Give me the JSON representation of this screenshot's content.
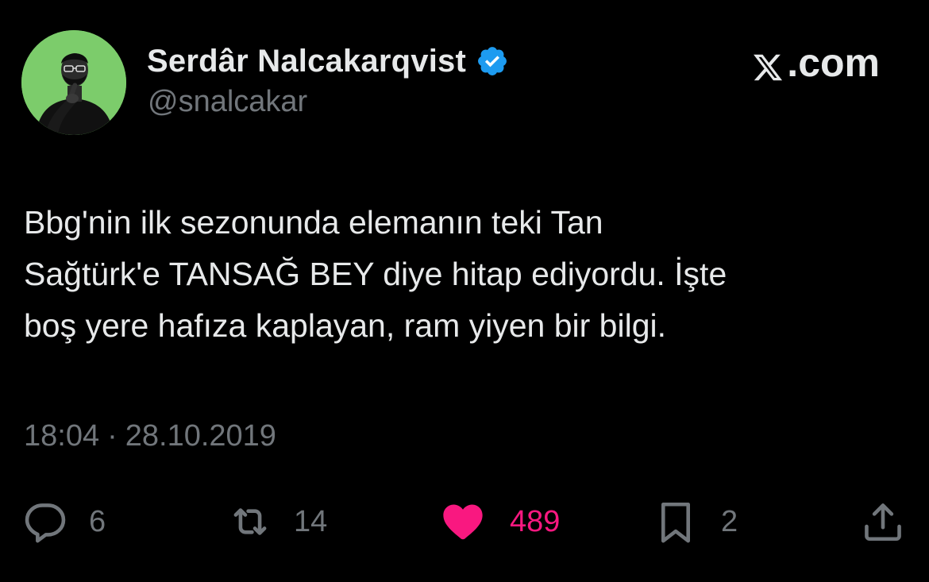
{
  "header": {
    "display_name": "Serdâr Nalcakarqvist",
    "handle": "@snalcakar",
    "verified_icon": "verified-badge-icon",
    "brand": ".com"
  },
  "colors": {
    "background": "#000000",
    "text": "#e7e9ea",
    "muted": "#71767b",
    "verified": "#1d9bf0",
    "like": "#f91880",
    "avatar_bg": "#7ccc6b"
  },
  "tweet": {
    "text": "Bbg'nin ilk sezonunda elemanın teki Tan\nSağtürk'e TANSAĞ BEY diye hitap ediyordu. İşte\nboş yere hafıza kaplayan, ram yiyen bir bilgi.",
    "time": "18:04",
    "separator": "·",
    "date": "28.10.2019"
  },
  "actions": {
    "reply": {
      "icon": "reply-icon",
      "count": "6"
    },
    "retweet": {
      "icon": "retweet-icon",
      "count": "14"
    },
    "like": {
      "icon": "heart-icon",
      "count": "489"
    },
    "bookmark": {
      "icon": "bookmark-icon",
      "count": "2"
    },
    "share": {
      "icon": "share-icon"
    }
  }
}
